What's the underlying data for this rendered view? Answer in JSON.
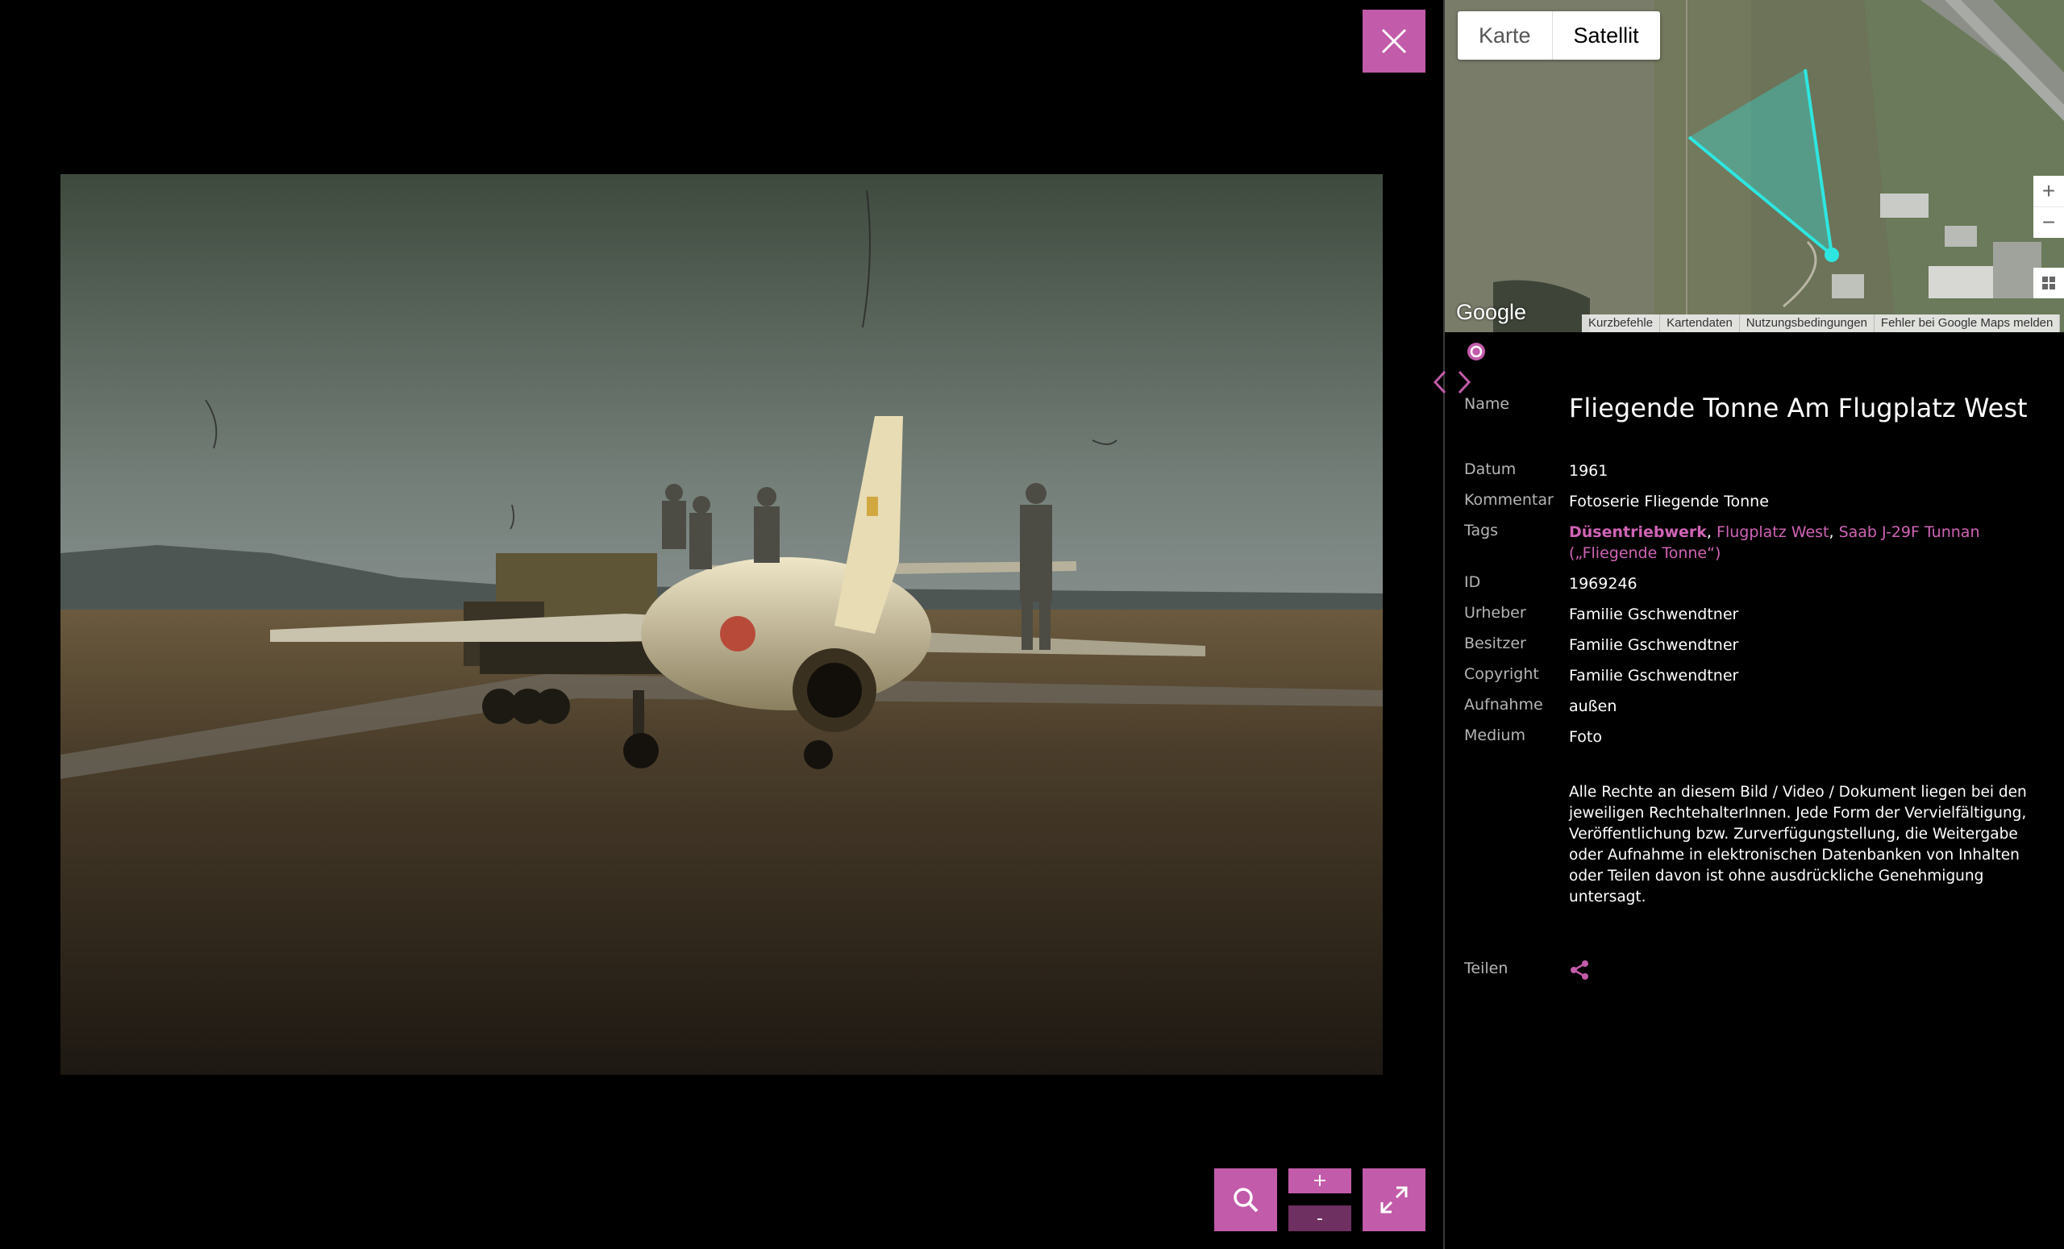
{
  "viewer": {
    "zoom_in_label": "+",
    "zoom_out_label": "-"
  },
  "map": {
    "tabs": [
      "Karte",
      "Satellit"
    ],
    "active_tab": "Satellit",
    "zoom_in": "+",
    "zoom_out": "−",
    "logo": "Google",
    "footer_links": [
      "Kurzbefehle",
      "Kartendaten",
      "Nutzungsbedingungen",
      "Fehler bei Google Maps melden"
    ]
  },
  "details": {
    "name_label": "Name",
    "name_value": "Fliegende Tonne Am Flugplatz West",
    "date_label": "Datum",
    "date_value": "1961",
    "comment_label": "Kommentar",
    "comment_value": "Fotoserie Fliegende Tonne",
    "tags_label": "Tags",
    "tags": [
      {
        "text": "Düsentriebwerk",
        "bold": true
      },
      {
        "text": "Flugplatz West",
        "bold": false
      },
      {
        "text": "Saab J-29F Tunnan („Fliegende Tonne“)",
        "bold": false
      }
    ],
    "id_label": "ID",
    "id_value": "1969246",
    "author_label": "Urheber",
    "author_value": "Familie Gschwendtner",
    "owner_label": "Besitzer",
    "owner_value": "Familie Gschwendtner",
    "copyright_label": "Copyright",
    "copyright_value": "Familie Gschwendtner",
    "shot_label": "Aufnahme",
    "shot_value": "außen",
    "medium_label": "Medium",
    "medium_value": "Foto",
    "rights_text": "Alle Rechte an diesem Bild / Video / Dokument liegen bei den jeweiligen RechtehalterInnen. Jede Form der Vervielfältigung, Veröffentlichung bzw. Zurverfügungstellung, die Weitergabe oder Aufnahme in elektronischen Datenbanken von Inhalten oder Teilen davon ist ohne ausdrückliche Genehmigung untersagt.",
    "share_label": "Teilen"
  },
  "colors": {
    "accent": "#c25ba9",
    "tag_link": "#d064b6",
    "label_gray": "#b5b5b5",
    "map_marker": "#2ee6e0"
  }
}
